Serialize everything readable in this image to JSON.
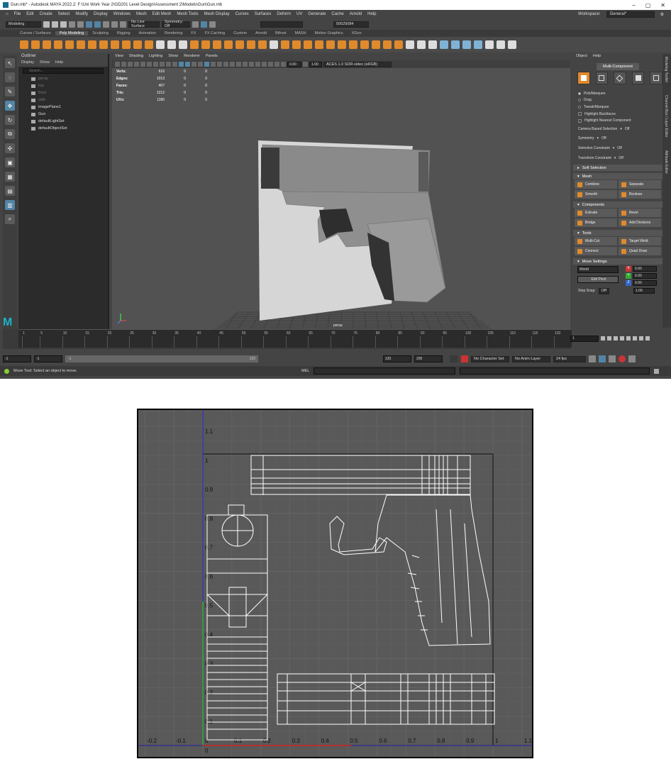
{
  "title_bar": {
    "text": "Gun.mb* - Autodesk MAYA 2022.2: F:\\Uni Work Year 2\\GD201 Level Design\\Assessment 2\\Models\\Gun\\Gun.mb"
  },
  "menu": [
    "File",
    "Edit",
    "Create",
    "Select",
    "Modify",
    "Display",
    "Windows",
    "Mesh",
    "Edit Mesh",
    "Mesh Tools",
    "Mesh Display",
    "Curves",
    "Surfaces",
    "Deform",
    "UV",
    "Generate",
    "Cache",
    "Arnold",
    "Help"
  ],
  "workspace": {
    "label": "Workspace:",
    "value": "General*"
  },
  "status_line": {
    "mode": "Modeling",
    "live_surface": "No Live Surface",
    "symmetry": "Symmetry: Off",
    "user_id": "50525084"
  },
  "shelf_tabs": [
    "Curves / Surfaces",
    "Poly Modeling",
    "Sculpting",
    "Rigging",
    "Animation",
    "Rendering",
    "FX",
    "FX Caching",
    "Custom",
    "Arnold",
    "Bifrost",
    "MASH",
    "Motion Graphics",
    "XGen"
  ],
  "shelf_active": "Poly Modeling",
  "outliner": {
    "title": "Outliner",
    "menu": [
      "Display",
      "Show",
      "Help"
    ],
    "search_placeholder": "Search...",
    "items": [
      {
        "label": "persp",
        "dim": true
      },
      {
        "label": "top",
        "dim": true
      },
      {
        "label": "front",
        "dim": true
      },
      {
        "label": "side",
        "dim": true
      },
      {
        "label": "imagePlane1",
        "dim": false
      },
      {
        "label": "Gun",
        "dim": false
      },
      {
        "label": "defaultLightSet",
        "dim": false
      },
      {
        "label": "defaultObjectSet",
        "dim": false
      }
    ]
  },
  "viewport": {
    "menu": [
      "View",
      "Shading",
      "Lighting",
      "Show",
      "Renderer",
      "Panels"
    ],
    "exposure": "0.00",
    "gamma": "1.00",
    "color_space": "ACES 1.0 SDR-video (sRGB)",
    "camera_label": "persp",
    "hud": [
      {
        "label": "Verts:",
        "v1": "616",
        "v2": "0",
        "v3": "0"
      },
      {
        "label": "Edges:",
        "v1": "1013",
        "v2": "0",
        "v3": "0"
      },
      {
        "label": "Faces:",
        "v1": "407",
        "v2": "0",
        "v3": "0"
      },
      {
        "label": "Tris:",
        "v1": "1212",
        "v2": "0",
        "v3": "0"
      },
      {
        "label": "UVs:",
        "v1": "1180",
        "v2": "0",
        "v3": "0"
      }
    ]
  },
  "modeling_toolkit": {
    "menu": [
      "Object",
      "Help"
    ],
    "multi_component": "Multi-Component",
    "selection_modes": [
      {
        "label": "Pick/Marquee",
        "on": true
      },
      {
        "label": "Drag",
        "on": false
      },
      {
        "label": "Tweak/Marquee",
        "on": false
      }
    ],
    "checks": [
      "Highlight Backfaces",
      "Highlight Nearest Component"
    ],
    "settings": [
      {
        "label": "Camera Based Selection",
        "value": "Off"
      },
      {
        "label": "Symmetry",
        "value": "Off"
      },
      {
        "label": "Selection Constraint",
        "value": "Off"
      },
      {
        "label": "Transform Constraint",
        "value": "Off"
      }
    ],
    "soft_selection": "Soft Selection",
    "sections": [
      {
        "title": "Mesh",
        "buttons": [
          "Combine",
          "Separate",
          "Smooth",
          "Boolean"
        ]
      },
      {
        "title": "Components",
        "buttons": [
          "Extrude",
          "Bevel",
          "Bridge",
          "Add Divisions"
        ]
      },
      {
        "title": "Tools",
        "buttons": [
          "Multi-Cut",
          "Target Weld",
          "Connect",
          "Quad Draw"
        ]
      }
    ],
    "move_settings": "Move Settings",
    "space": "World",
    "edit_pivot": "Edit Pivot",
    "axis_values": {
      "x": "0.00",
      "y": "0.00",
      "z": "0.00"
    },
    "step_snap": {
      "label": "Step Snap:",
      "value": "Off",
      "amount": "1.00"
    }
  },
  "side_tabs": [
    "Modeling Toolkit",
    "Channel Box / Layer Editor",
    "Attribute Editor"
  ],
  "timeline": {
    "ticks": [
      "1",
      "5",
      "10",
      "15",
      "20",
      "25",
      "30",
      "35",
      "40",
      "45",
      "50",
      "55",
      "60",
      "65",
      "70",
      "75",
      "80",
      "85",
      "90",
      "95",
      "100",
      "105",
      "110",
      "115",
      "120"
    ],
    "current_frame": "1"
  },
  "range": {
    "start": "-1",
    "anim_start": "-1",
    "slider_start": "-1",
    "slider_end": "120",
    "anim_end": "120",
    "end": "200",
    "character_set": "No Character Set",
    "anim_layer": "No Anim Layer",
    "fps": "24 fps"
  },
  "status": {
    "help": "Move Tool: Select an object to move.",
    "mel": "MEL"
  },
  "uv_editor": {
    "x_labels": [
      "-0.2",
      "-0.1",
      "0",
      "0.1",
      "0.2",
      "0.3",
      "0.4",
      "0.5",
      "0.6",
      "0.7",
      "0.8",
      "0.9",
      "1",
      "1.1"
    ],
    "y_labels": [
      "1.1",
      "1",
      "0.9",
      "0.8",
      "0.7",
      "0.6",
      "0.5",
      "0.4",
      "0.3",
      "0.2",
      "0.1",
      "0"
    ]
  }
}
